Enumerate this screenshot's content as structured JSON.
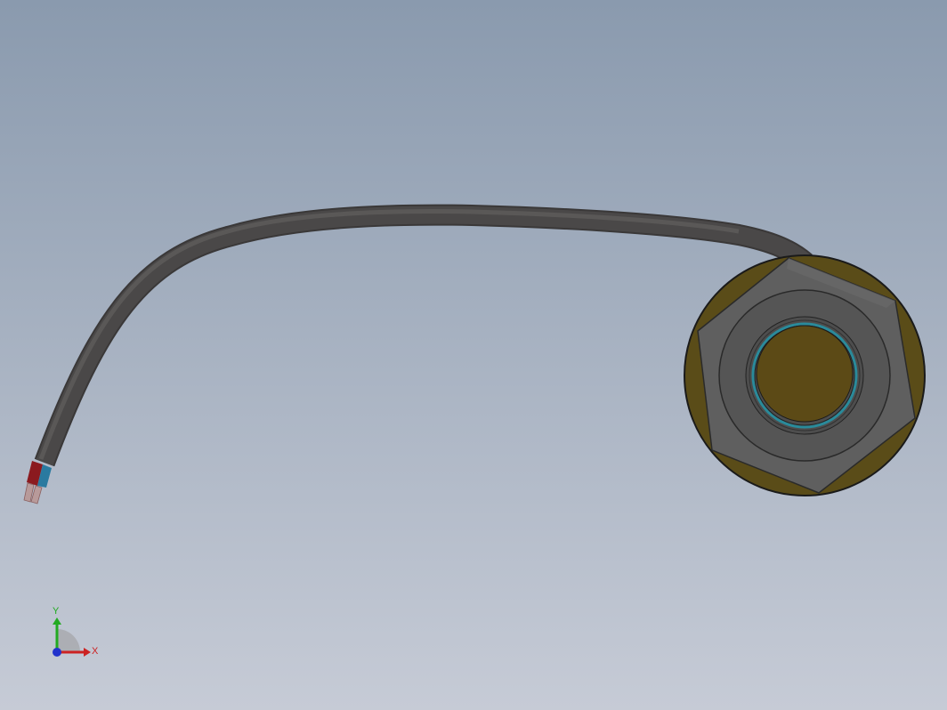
{
  "colors": {
    "background_top": "#8a9aae",
    "background_bottom": "#c6cbd6",
    "cable": "#4a4848",
    "cable_highlight": "#5e5c5b",
    "cable_shadow": "#3a3838",
    "flange": "#5a4c18",
    "hex_nut": "#5f5f5f",
    "hex_nut_face": "#555555",
    "collar": "#4d4d4d",
    "sensor_face": "#5c4a16",
    "sensor_ring": "#2a8a9a",
    "wire_red": "#8b1a1f",
    "wire_blue": "#2a7aa0",
    "conductor": "#b89a9a",
    "axis_x": "#cc2222",
    "axis_y": "#22aa22",
    "axis_z": "#2233cc"
  },
  "triad": {
    "x_label": "X",
    "y_label": "Y"
  },
  "icons": {
    "triad": "coordinate-triad-icon"
  }
}
